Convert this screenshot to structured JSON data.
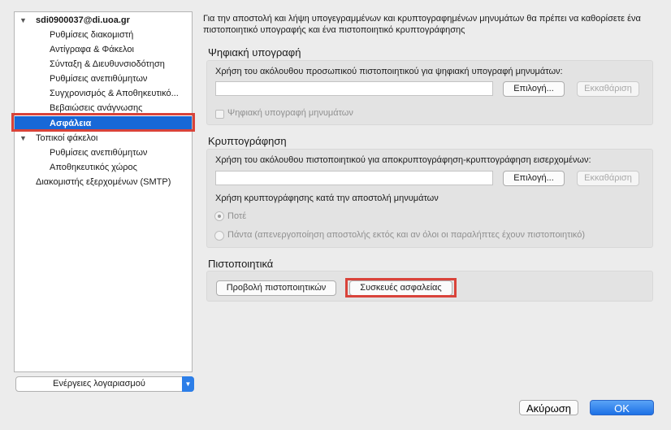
{
  "sidebar": {
    "account": {
      "email": "sdi0900037@di.uoa.gr"
    },
    "account_items": [
      {
        "label": "Ρυθμίσεις διακομιστή"
      },
      {
        "label": "Αντίγραφα & Φάκελοι"
      },
      {
        "label": "Σύνταξη & Διευθυνσιοδότηση"
      },
      {
        "label": "Ρυθμίσεις ανεπιθύμητων"
      },
      {
        "label": "Συγχρονισμός & Αποθηκευτικό..."
      },
      {
        "label": "Βεβαιώσεις ανάγνωσης"
      },
      {
        "label": "Ασφάλεια"
      }
    ],
    "local_folders": {
      "label": "Τοπικοί φάκελοι"
    },
    "local_items": [
      {
        "label": "Ρυθμίσεις ανεπιθύμητων"
      },
      {
        "label": "Αποθηκευτικός χώρος"
      }
    ],
    "smtp": {
      "label": "Διακομιστής εξερχομένων (SMTP)"
    },
    "account_actions": {
      "label": "Ενέργειες λογαριασμού"
    }
  },
  "main": {
    "intro": "Για την αποστολή και λήψη υπογεγραμμένων και κρυπτογραφημένων μηνυμάτων θα πρέπει να καθορίσετε ένα πιστοποιητικό υπογραφής και ένα πιστοποιητικό κρυπτογράφησης",
    "signing": {
      "title": "Ψηφιακή υπογραφή",
      "desc": "Χρήση του ακόλουθου προσωπικού πιστοποιητικού για ψηφιακή υπογραφή μηνυμάτων:",
      "cert_value": "",
      "select_label": "Επιλογή...",
      "clear_label": "Εκκαθάριση",
      "checkbox_label": "Ψηφιακή υπογραφή μηνυμάτων"
    },
    "encryption": {
      "title": "Κρυπτογράφηση",
      "desc": "Χρήση του ακόλουθου πιστοποιητικού για αποκρυπτογράφηση-κρυπτογράφηση εισερχομένων:",
      "cert_value": "",
      "select_label": "Επιλογή...",
      "clear_label": "Εκκαθάριση",
      "sending_label": "Χρήση κρυπτογράφησης κατά την αποστολή μηνυμάτων",
      "radio_never": "Ποτέ",
      "radio_always": "Πάντα (απενεργοποίηση αποστολής εκτός και αν όλοι οι παραλήπτες έχουν πιστοποιητικό)"
    },
    "certificates": {
      "title": "Πιστοποιητικά",
      "view_label": "Προβολή πιστοποιητικών",
      "devices_label": "Συσκευές ασφαλείας"
    }
  },
  "footer": {
    "cancel_label": "Ακύρωση",
    "ok_label": "OK"
  },
  "colors": {
    "selection": "#1868d7",
    "highlight_box": "#d9433a",
    "ok_button": "#1d71e6"
  }
}
